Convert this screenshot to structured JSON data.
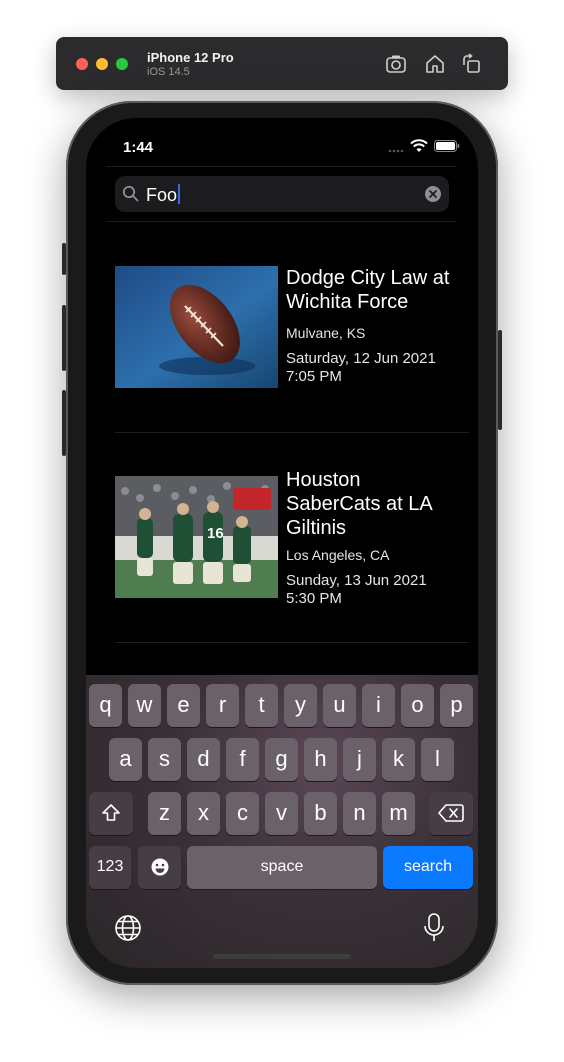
{
  "simulator": {
    "device_name": "iPhone 12 Pro",
    "os_version": "iOS 14.5",
    "icons": [
      "screenshot-icon",
      "home-icon",
      "rotate-icon"
    ]
  },
  "status_bar": {
    "time": "1:44",
    "icons": [
      "wifi-icon",
      "battery-icon"
    ]
  },
  "search": {
    "value": "Foo",
    "icons": [
      "search-icon",
      "clear-icon"
    ]
  },
  "results": [
    {
      "title": "Dodge City Law at Wichita Force",
      "location": "Mulvane, KS",
      "date": "Saturday, 12 Jun 2021",
      "time": "7:05 PM",
      "image": "football-photo"
    },
    {
      "title": "Houston SaberCats at LA Giltinis",
      "location": "Los Angeles, CA",
      "date": "Sunday, 13 Jun 2021",
      "time": "5:30 PM",
      "image": "game-action-photo"
    }
  ],
  "keyboard": {
    "row1": [
      "q",
      "w",
      "e",
      "r",
      "t",
      "y",
      "u",
      "i",
      "o",
      "p"
    ],
    "row2": [
      "a",
      "s",
      "d",
      "f",
      "g",
      "h",
      "j",
      "k",
      "l"
    ],
    "row3": [
      "z",
      "x",
      "c",
      "v",
      "b",
      "n",
      "m"
    ],
    "numbers_label": "123",
    "space_label": "space",
    "search_label": "search",
    "icons": [
      "shift-icon",
      "backspace-icon",
      "emoji-icon",
      "globe-icon",
      "microphone-icon"
    ]
  },
  "colors": {
    "accent": "#0a7aff",
    "background": "#000000"
  }
}
